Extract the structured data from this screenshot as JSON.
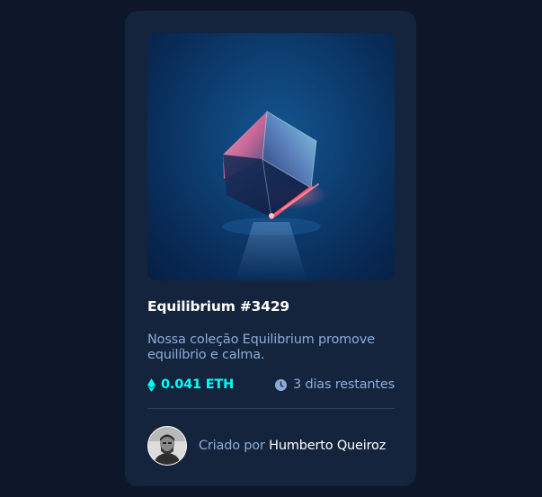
{
  "card": {
    "title": "Equilibrium #3429",
    "description": "Nossa coleção Equilibrium promove equilíbrio e calma.",
    "price": "0.041 ETH",
    "time_left": "3 dias restantes",
    "creator_prefix": "Criado por",
    "creator_name": "Humberto Queiroz"
  },
  "icons": {
    "price": "ethereum-icon",
    "time": "clock-icon",
    "avatar": "avatar-photo"
  },
  "colors": {
    "background": "#0e1729",
    "card": "#15243d",
    "accent_cyan": "#00fff8",
    "soft_blue": "#8bacd9",
    "white": "#ffffff",
    "divider": "#2e405a"
  }
}
